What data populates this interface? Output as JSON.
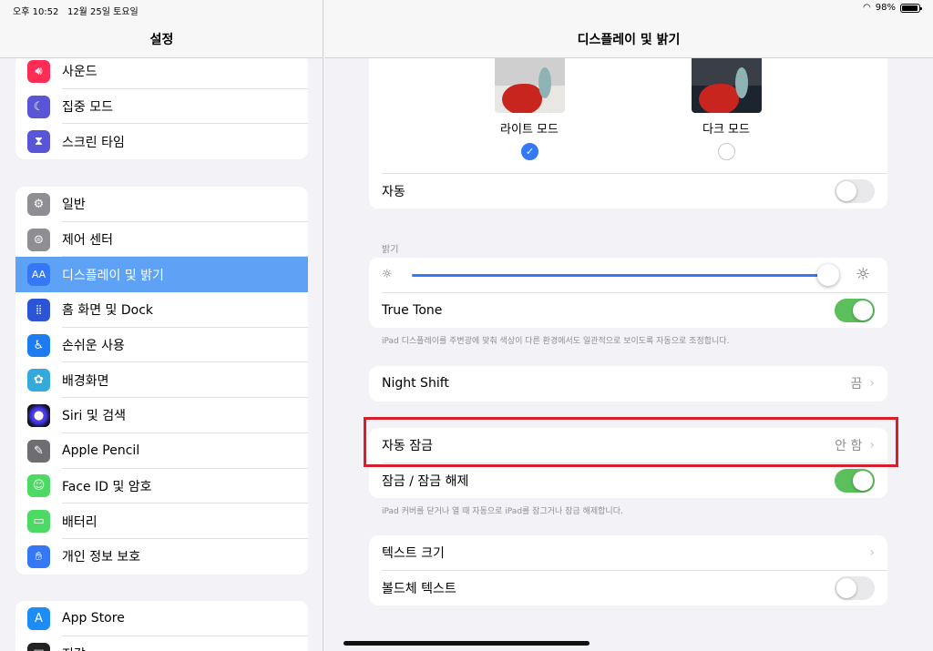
{
  "status": {
    "time": "오후 10:52",
    "date": "12월 25일 토요일",
    "battery": "98%"
  },
  "sidebar": {
    "title": "설정",
    "group1": [
      {
        "label": "사운드",
        "icon": "speaker-icon",
        "color": "#ff2d55"
      },
      {
        "label": "집중 모드",
        "icon": "moon-icon",
        "color": "#5856d6"
      },
      {
        "label": "스크린 타임",
        "icon": "hourglass-icon",
        "color": "#5856d6"
      }
    ],
    "group2": [
      {
        "label": "일반",
        "icon": "gear-icon",
        "color": "#8e8e93"
      },
      {
        "label": "제어 센터",
        "icon": "switches-icon",
        "color": "#8e8e93"
      },
      {
        "label": "디스플레이 및 밝기",
        "icon": "aa-icon",
        "color": "#3478f6",
        "selected": true
      },
      {
        "label": "홈 화면 및 Dock",
        "icon": "grid-icon",
        "color": "#2c54d6"
      },
      {
        "label": "손쉬운 사용",
        "icon": "accessibility-icon",
        "color": "#1e7cf2"
      },
      {
        "label": "배경화면",
        "icon": "flower-icon",
        "color": "#34aadc"
      },
      {
        "label": "Siri 및 검색",
        "icon": "siri-icon",
        "color": "#222222"
      },
      {
        "label": "Apple Pencil",
        "icon": "pencil-icon",
        "color": "#6d6d72"
      },
      {
        "label": "Face ID 및 암호",
        "icon": "faceid-icon",
        "color": "#4cd964"
      },
      {
        "label": "배터리",
        "icon": "battery-icon",
        "color": "#4cd964"
      },
      {
        "label": "개인 정보 보호",
        "icon": "hand-icon",
        "color": "#3478f6"
      }
    ],
    "group3": [
      {
        "label": "App Store",
        "icon": "appstore-icon",
        "color": "#1e8cf5"
      },
      {
        "label": "지갑",
        "icon": "wallet-icon",
        "color": "#222222"
      }
    ]
  },
  "main": {
    "title": "디스플레이 및 밝기",
    "appearance": {
      "light_label": "라이트 모드",
      "dark_label": "다크 모드",
      "selected": "light"
    },
    "auto_label": "자동",
    "auto_on": false,
    "brightness_title": "밝기",
    "brightness_level": 0.94,
    "true_tone_label": "True Tone",
    "true_tone_on": true,
    "true_tone_note": "iPad 디스플레이를 주변광에 맞춰 색상이 다른 환경에서도 일관적으로 보이도록 자동으로 조정합니다.",
    "night_shift_label": "Night Shift",
    "night_shift_value": "끔",
    "auto_lock_label": "자동 잠금",
    "auto_lock_value": "안 함",
    "lock_unlock_label": "잠금 / 잠금 해제",
    "lock_unlock_on": true,
    "lock_unlock_note": "iPad 커버를 닫거나 열 때 자동으로 iPad를 잠그거나 잠금 해제합니다.",
    "text_size_label": "텍스트 크기",
    "bold_text_label": "볼드체 텍스트",
    "bold_text_on": false,
    "chevron": "›"
  }
}
